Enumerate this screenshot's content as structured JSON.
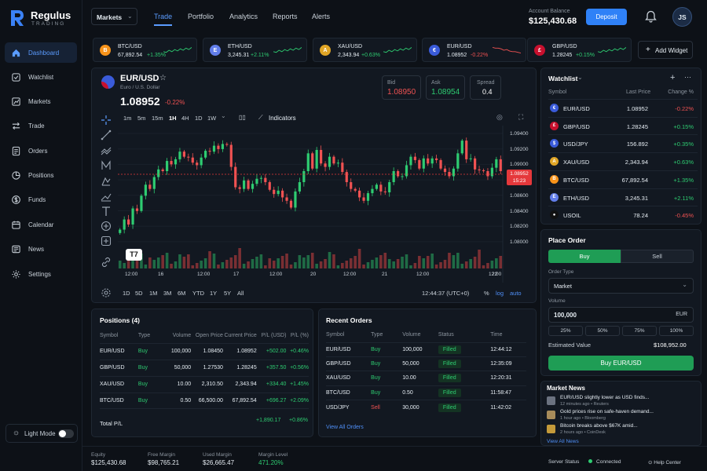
{
  "brand": {
    "name": "Regulus",
    "sub": "TRADING"
  },
  "header": {
    "market_select": "Markets",
    "tabs": [
      "Trade",
      "Portfolio",
      "Analytics",
      "Reports",
      "Alerts"
    ],
    "balance_label": "Account Balance",
    "balance_value": "$125,430.68",
    "deposit_label": "Deposit",
    "avatar": "JS"
  },
  "sidebar": {
    "items": [
      {
        "label": "Dashboard",
        "icon": "home-icon"
      },
      {
        "label": "Watchlist",
        "icon": "eye-icon"
      },
      {
        "label": "Markets",
        "icon": "chart-icon"
      },
      {
        "label": "Trade",
        "icon": "arrows-icon"
      },
      {
        "label": "Orders",
        "icon": "orders-icon"
      },
      {
        "label": "Positions",
        "icon": "pie-icon"
      },
      {
        "label": "Funds",
        "icon": "dollar-icon"
      },
      {
        "label": "Calendar",
        "icon": "calendar-icon"
      },
      {
        "label": "News",
        "icon": "news-icon"
      },
      {
        "label": "Settings",
        "icon": "gear-icon"
      }
    ],
    "light_mode": "Light Mode"
  },
  "tickers": [
    {
      "symbol": "BTC/USD",
      "price": "67,892.54",
      "change": "+1.35%",
      "dir": "up",
      "coin": "B",
      "color": "#f7931a"
    },
    {
      "symbol": "ETH/USD",
      "price": "3,245.31",
      "change": "+2.11%",
      "dir": "up",
      "coin": "E",
      "color": "#627eea"
    },
    {
      "symbol": "XAU/USD",
      "price": "2,343.94",
      "change": "+0.63%",
      "dir": "up",
      "coin": "A",
      "color": "#e0a526"
    },
    {
      "symbol": "EUR/USD",
      "price": "1.08952",
      "change": "-0.22%",
      "dir": "down",
      "coin": "€",
      "color": "#3a5bd9"
    },
    {
      "symbol": "GBP/USD",
      "price": "1.28245",
      "change": "+0.15%",
      "dir": "up",
      "coin": "£",
      "color": "#c8102e"
    }
  ],
  "add_widget": "Add Widget",
  "chart_header": {
    "pair": "EUR/USD",
    "desc": "Euro / U.S. Dollar",
    "price": "1.08952",
    "change": "-0.22%",
    "bid_label": "Bid",
    "bid": "1.08950",
    "ask_label": "Ask",
    "ask": "1.08954",
    "spread_label": "Spread",
    "spread": "0.4",
    "timeframes": [
      "1m",
      "5m",
      "15m",
      "1H",
      "4H",
      "1D",
      "1W"
    ],
    "indicators": "Indicators",
    "current_label": "1.08952",
    "current_sub": "15:23",
    "ranges": [
      "1D",
      "5D",
      "1M",
      "3M",
      "6M",
      "YTD",
      "1Y",
      "5Y",
      "All"
    ],
    "clock": "12:44:37 (UTC+0)",
    "pct": "%",
    "log": "log",
    "auto": "auto"
  },
  "chart_data": {
    "type": "candlestick",
    "x_ticks": [
      "12:00",
      "16",
      "12:00",
      "17",
      "12:00",
      "20",
      "12:00",
      "21",
      "12:00",
      "18",
      "12:00",
      "22"
    ],
    "y_ticks": [
      "1.09400",
      "1.09200",
      "1.09000",
      "1.08800",
      "1.08600",
      "1.08400",
      "1.08200",
      "1.08000"
    ],
    "ylim": [
      1.0795,
      1.0945
    ],
    "closes": [
      1.0826,
      1.0838,
      1.0832,
      1.0851,
      1.0848,
      1.0866,
      1.0879,
      1.0874,
      1.0888,
      1.0897,
      1.0895,
      1.0907,
      1.0903,
      1.0909,
      1.0918,
      1.0912,
      1.0911,
      1.0905,
      1.0902,
      1.0911,
      1.0919,
      1.0918,
      1.0925,
      1.0921,
      1.0927,
      1.0926,
      1.09,
      1.0876,
      1.0874,
      1.0884,
      1.0874,
      1.088,
      1.0886,
      1.0887,
      1.0882,
      1.0873,
      1.0868,
      1.0872,
      1.0864,
      1.086,
      1.0852,
      1.0871,
      1.0882,
      1.0895,
      1.0916,
      1.0898,
      1.092,
      1.0904,
      1.09,
      1.0912,
      1.0904,
      1.0905,
      1.0894,
      1.0882,
      1.0874,
      1.0872,
      1.0864,
      1.086,
      1.0869,
      1.0874,
      1.0879,
      1.0871,
      1.087,
      1.0882,
      1.0895,
      1.0889,
      1.0889,
      1.0902,
      1.0912,
      1.0908,
      1.0898,
      1.091,
      1.0904,
      1.091,
      1.0908,
      1.0898,
      1.0894,
      1.0889,
      1.0898,
      1.0916,
      1.0931,
      1.0909,
      1.091,
      1.0897,
      1.0896,
      1.0895,
      1.0889,
      1.0899,
      1.0909,
      1.0895
    ]
  },
  "positions": {
    "title": "Positions (4)",
    "headers": [
      "Symbol",
      "Type",
      "Volume",
      "Open Price",
      "Current Price",
      "P/L (USD)",
      "P/L (%)"
    ],
    "rows": [
      [
        "EUR/USD",
        "Buy",
        "100,000",
        "1.08450",
        "1.08952",
        "+502.00",
        "+0.46%"
      ],
      [
        "GBP/USD",
        "Buy",
        "50,000",
        "1.27530",
        "1.28245",
        "+357.50",
        "+0.56%"
      ],
      [
        "XAU/USD",
        "Buy",
        "10.00",
        "2,310.50",
        "2,343.94",
        "+334.40",
        "+1.45%"
      ],
      [
        "BTC/USD",
        "Buy",
        "0.50",
        "66,500.00",
        "67,892.54",
        "+696.27",
        "+2.09%"
      ]
    ],
    "total_label": "Total P/L",
    "total_usd": "+1,890.17",
    "total_pct": "+0.86%"
  },
  "orders": {
    "title": "Recent Orders",
    "headers": [
      "Symbol",
      "Type",
      "Volume",
      "Status",
      "Time"
    ],
    "rows": [
      [
        "EUR/USD",
        "Buy",
        "100,000",
        "Filled",
        "12:44:12"
      ],
      [
        "GBP/USD",
        "Buy",
        "50,000",
        "Filled",
        "12:35:09"
      ],
      [
        "XAU/USD",
        "Buy",
        "10.00",
        "Filled",
        "12:20:31"
      ],
      [
        "BTC/USD",
        "Buy",
        "0.50",
        "Filled",
        "11:58:47"
      ],
      [
        "USD/JPY",
        "Sell",
        "30,000",
        "Filled",
        "11:42:02"
      ]
    ],
    "view_all": "View All Orders"
  },
  "watchlist": {
    "title": "Watchlist",
    "headers": [
      "Symbol",
      "Last Price",
      "Change %"
    ],
    "rows": [
      {
        "symbol": "EUR/USD",
        "price": "1.08952",
        "change": "-0.22%",
        "dir": "down",
        "coin": "€",
        "color": "#3a5bd9"
      },
      {
        "symbol": "GBP/USD",
        "price": "1.28245",
        "change": "+0.15%",
        "dir": "up",
        "coin": "£",
        "color": "#c8102e"
      },
      {
        "symbol": "USD/JPY",
        "price": "156.892",
        "change": "+0.35%",
        "dir": "up",
        "coin": "$",
        "color": "#3a5bd9"
      },
      {
        "symbol": "XAU/USD",
        "price": "2,343.94",
        "change": "+0.63%",
        "dir": "up",
        "coin": "A",
        "color": "#e0a526"
      },
      {
        "symbol": "BTC/USD",
        "price": "67,892.54",
        "change": "+1.35%",
        "dir": "up",
        "coin": "B",
        "color": "#f7931a"
      },
      {
        "symbol": "ETH/USD",
        "price": "3,245.31",
        "change": "+2.11%",
        "dir": "up",
        "coin": "E",
        "color": "#627eea"
      },
      {
        "symbol": "USOIL",
        "price": "78.24",
        "change": "-0.45%",
        "dir": "down",
        "coin": "●",
        "color": "#111111"
      }
    ]
  },
  "place_order": {
    "title": "Place Order",
    "buy": "Buy",
    "sell": "Sell",
    "order_type_label": "Order Type",
    "order_type": "Market",
    "volume_label": "Volume",
    "volume": "100,000",
    "currency": "EUR",
    "presets": [
      "25%",
      "50%",
      "75%",
      "100%"
    ],
    "est_label": "Estimated Value",
    "est_value": "$108,952.00",
    "submit": "Buy EUR/USD"
  },
  "news": {
    "title": "Market News",
    "items": [
      {
        "headline": "EUR/USD slightly lower as USD finds...",
        "meta": "12 minutes ago • Reuters"
      },
      {
        "headline": "Gold prices rise on safe-haven demand...",
        "meta": "1 hour ago • Bloomberg"
      },
      {
        "headline": "Bitcoin breaks above $67K amid...",
        "meta": "2 hours ago • CoinDesk"
      }
    ],
    "view_all": "View All News"
  },
  "footer": {
    "stats": [
      {
        "label": "Equity",
        "value": "$125,430.68"
      },
      {
        "label": "Free Margin",
        "value": "$98,765.21"
      },
      {
        "label": "Used Margin",
        "value": "$26,665.47"
      },
      {
        "label": "Margin Level",
        "value": "471.20%"
      }
    ],
    "server_label": "Server Status",
    "server_value": "Connected",
    "help": "Help Center"
  },
  "colors": {
    "accent": "#2f81f7",
    "up": "#2ecc71",
    "down": "#f05252",
    "bg": "#0d1117"
  }
}
